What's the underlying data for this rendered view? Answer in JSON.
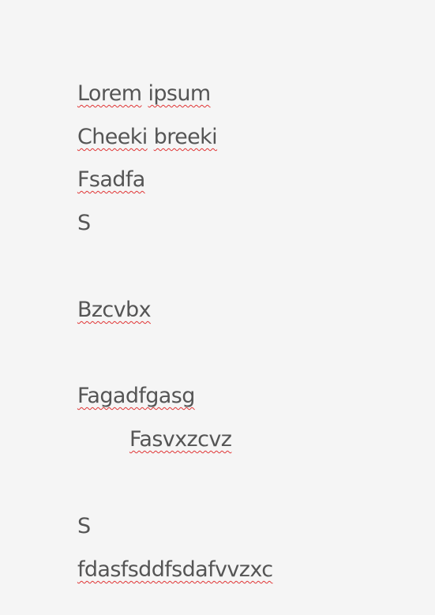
{
  "document": {
    "lines": [
      {
        "words": [
          "Lorem",
          "ipsum"
        ]
      },
      {
        "words": [
          "Cheeki",
          "breeki"
        ]
      },
      {
        "words": [
          "Fsadfa"
        ]
      },
      {
        "words": [
          "S"
        ]
      },
      {
        "words": [
          "Bzcvbx"
        ]
      },
      {
        "words": [
          "Fagadfgasg"
        ]
      },
      {
        "words": [
          "Fasvxzcvz"
        ]
      },
      {
        "words": [
          "S"
        ]
      },
      {
        "words": [
          "fdasfsddfsdafvvzxc"
        ]
      }
    ]
  },
  "colors": {
    "background": "#f5f5f5",
    "text": "#555555",
    "spellcheck_underline": "#e03434"
  }
}
